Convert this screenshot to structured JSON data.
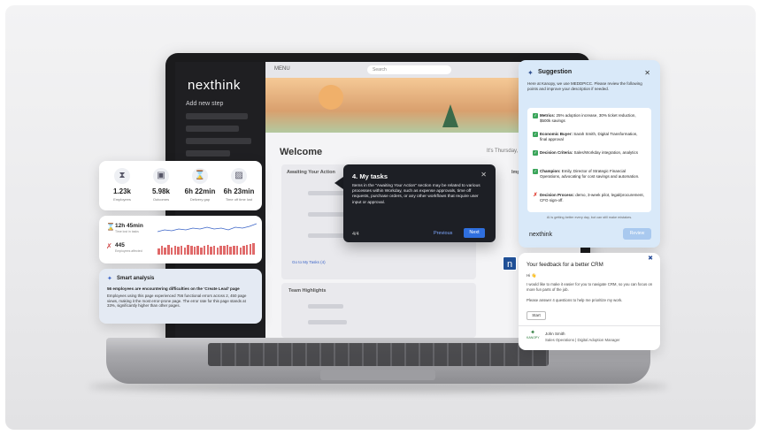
{
  "screen": {
    "brand": "nexthink",
    "sidebar_title": "Add new step",
    "menu_label": "MENU",
    "search_placeholder": "Search",
    "welcome": "Welcome",
    "date": "It's Thursday, F",
    "awaiting_label": "Awaiting Your Action",
    "important_label": "Important Di",
    "team_highlights": "Team Highlights",
    "go_to_tasks": "Go to My Tasks (4)"
  },
  "metrics": [
    {
      "icon": "person-icon",
      "glyph": "⧗",
      "value": "1.23k",
      "label": "Employees"
    },
    {
      "icon": "chip-icon",
      "glyph": "▣",
      "value": "5.98k",
      "label": "Outcomes"
    },
    {
      "icon": "hourglass-icon",
      "glyph": "⌛",
      "value": "6h 22min",
      "label": "Delivery gap"
    },
    {
      "icon": "image-icon",
      "glyph": "▨",
      "value": "6h 23min",
      "label": "Time off time lost"
    }
  ],
  "analytics": {
    "row1_value": "12h 45min",
    "row1_sub": "Time lost in tasks",
    "row2_value": "445",
    "row2_sub": "Employees affected",
    "bar_heights": [
      0.5,
      0.7,
      0.6,
      0.8,
      0.55,
      0.75,
      0.65,
      0.7,
      0.6,
      0.8,
      0.7,
      0.65,
      0.75,
      0.6,
      0.7,
      0.8,
      0.65,
      0.7,
      0.6,
      0.75,
      0.7,
      0.8,
      0.65,
      0.7,
      0.75,
      0.6,
      0.7,
      0.8,
      0.85,
      0.9
    ]
  },
  "smart": {
    "title": "Smart analysis",
    "headline": "56 employees are encountering difficulties on the 'Create Lead' page",
    "body": "Employees using this page experienced 756 functional errors across 2, 450 page views, making it the most error-prone page. The error rate for this page stands at 33%, significantly higher than other pages."
  },
  "tooltip": {
    "title": "4. My tasks",
    "body": "Items in the \"Awaiting Your Action\" section may be related to various processes within Workday, such as expense approvals, time off requests, purchase orders, or any other workflows that require user input or approval.",
    "count": "4/4",
    "previous": "Previous",
    "next": "Next",
    "accent": "#2f6fde"
  },
  "suggestion": {
    "title": "Suggestion",
    "intro": "Here at Kanopy, we use MEDDPICC. Please review the following points and improve your description if needed.",
    "items": [
      {
        "status": "ok",
        "label": "Metrics:",
        "text": "25% adoption increase, 30% ticket reduction, $500k savings"
      },
      {
        "status": "ok",
        "label": "Economic Buyer:",
        "text": "Sarah Smith, Digital Transformation, final approval"
      },
      {
        "status": "ok",
        "label": "Decision Criteria:",
        "text": "Sales/Workday integration, analytics"
      },
      {
        "status": "ok",
        "label": "Champion:",
        "text": "Emily, Director of Strategic Financial Operations, advocating for cost savings and automation."
      },
      {
        "status": "missing",
        "label": "Decision Process:",
        "text": "demo, 3-week pilot, legal/procurement, CFO sign-off."
      }
    ],
    "footer": "AI is getting better every day, but can still make mistakes.",
    "logo": "nexthink",
    "review": "Review",
    "ok_color": "#3aa55a",
    "missing_color": "#e03b2f"
  },
  "feedback": {
    "title": "Your feedback for a better CRM",
    "hi": "Hi 👋",
    "body": "I would like to make it easier for you to navigate CRM, so you can focus on more fun parts of the job.",
    "body2": "Please answer 4 questions to help me prioritize my work.",
    "start": "Start",
    "avatar_text": "KANOPY",
    "name": "John Smith",
    "role": "Sales Operations | Digital Adoption Manager"
  }
}
